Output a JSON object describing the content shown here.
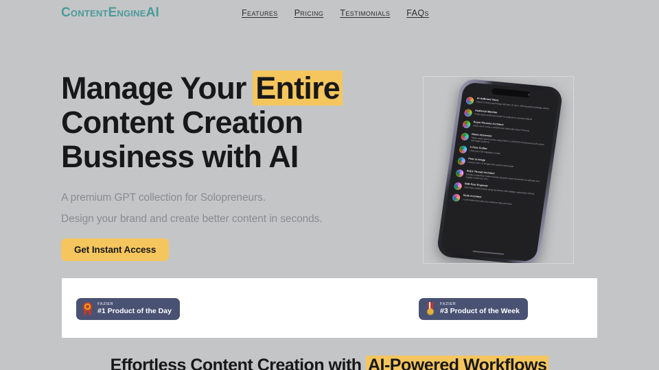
{
  "brand": {
    "name": "ContentEngine AI",
    "name_main": "ContentEngine",
    "name_suffix": "AI",
    "color": "#4a9b9b"
  },
  "colors": {
    "page_background": "#c4c5c7",
    "accent_yellow": "#f5c65d",
    "badge_navy": "#4a5273",
    "card_white": "#ffffff",
    "heading_dark": "#18181a",
    "muted_text": "#8a8b8e"
  },
  "nav": {
    "items": [
      {
        "label": "Features",
        "name": "nav-link-features"
      },
      {
        "label": "Pricing",
        "name": "nav-link-pricing"
      },
      {
        "label": "Testimonials",
        "name": "nav-link-testimonials"
      },
      {
        "label": "FAQs",
        "name": "nav-link-faqs"
      }
    ]
  },
  "hero": {
    "title_line1_a": "Manage Your ",
    "title_line1_highlight": "Entire",
    "title_line2": "Content Creation",
    "title_line3": "Business with AI",
    "subtitle_1": "A premium GPT collection for Solopreneurs.",
    "subtitle_2": "Design your brand and create better content in seconds.",
    "cta_label": "Get Instant Access"
  },
  "phone_mockup": {
    "gpt_items": [
      {
        "name": "AI-AdBrand Voice",
        "description": "Expert in brand psychology and tone of voice, offering guided strategic advice"
      },
      {
        "name": "Audience Matcher",
        "description": "Finds target audiences based on products or services offered"
      },
      {
        "name": "Buyer Persona Architect",
        "description": "Helps users create a detailed and actionable Buyer Persona"
      },
      {
        "name": "Name Alchemist",
        "description": "Helps create brand names using SMILE & SCRATCH frameworks to fit values and target audience"
      },
      {
        "name": "X Post Crafter",
        "description": "I help you craft engaging X posts"
      },
      {
        "name": "Post to Image",
        "description": "Creates DALL-E images from social media posts"
      },
      {
        "name": "AI@X Thread Architect",
        "description": "Creates compelling Twitter threads using the Hook framework to captivate and engage audiences, driv..."
      },
      {
        "name": "B2B Post Engineer",
        "description": "Generates content ideas using the Before-After-Bridge copywriting method"
      },
      {
        "name": "Hook Architect",
        "description": "I craft hooks that make your audience stop and stare"
      }
    ]
  },
  "badges": {
    "items": [
      {
        "platform": "FAZIER",
        "title": "#1 Product of the Day",
        "icon": "rosette-award-icon",
        "name": "badge-product-of-the-day"
      },
      {
        "platform": "FAZIER",
        "title": "#3 Product of the Week",
        "icon": "medal-icon",
        "name": "badge-product-of-the-week"
      }
    ]
  },
  "section": {
    "heading_prefix": "Effortless Content Creation with ",
    "heading_highlight": "AI-Powered Workflows"
  }
}
